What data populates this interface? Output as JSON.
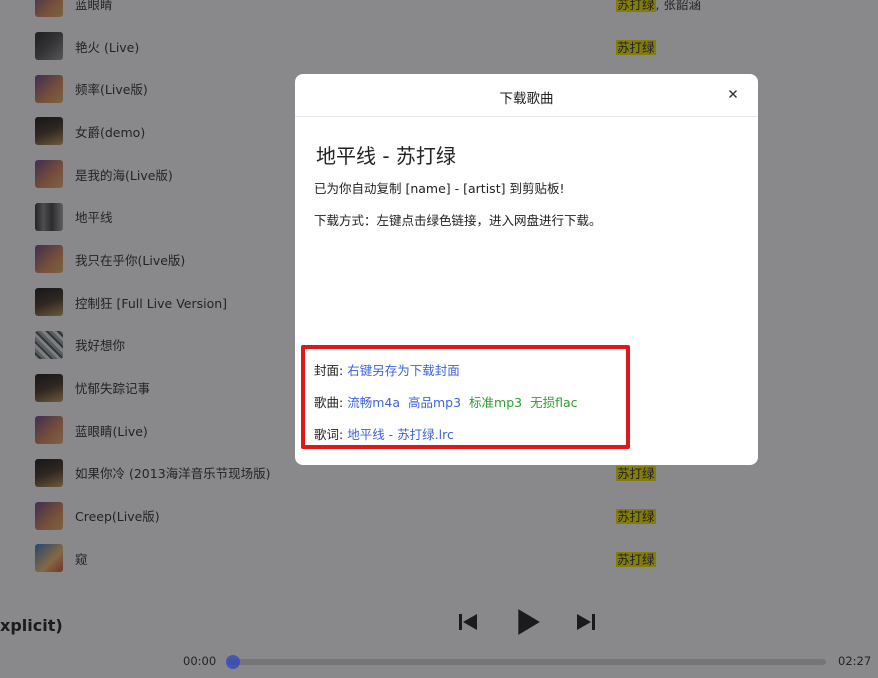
{
  "songs": [
    {
      "name": "蓝眼睛",
      "artist": "苏打绿",
      "artist_extra": ", 张韶涵",
      "cover": "c0"
    },
    {
      "name": "艳火 (Live)",
      "artist": "苏打绿",
      "artist_extra": "",
      "cover": "c1"
    },
    {
      "name": "频率(Live版)",
      "artist": "",
      "artist_extra": "",
      "cover": "c0"
    },
    {
      "name": "女爵(demo)",
      "artist": "",
      "artist_extra": "",
      "cover": "c2"
    },
    {
      "name": "是我的海(Live版)",
      "artist": "",
      "artist_extra": "",
      "cover": "c0"
    },
    {
      "name": "地平线",
      "artist": "",
      "artist_extra": "",
      "cover": "c5"
    },
    {
      "name": "我只在乎你(Live版)",
      "artist": "",
      "artist_extra": "",
      "cover": "c0"
    },
    {
      "name": "控制狂 [Full Live Version]",
      "artist": "",
      "artist_extra": "",
      "cover": "c2"
    },
    {
      "name": "我好想你",
      "artist": "",
      "artist_extra": "",
      "cover": "c3"
    },
    {
      "name": "忧郁失踪记事",
      "artist": "",
      "artist_extra": "",
      "cover": "c2"
    },
    {
      "name": "蓝眼睛(Live)",
      "artist": "",
      "artist_extra": "",
      "cover": "c0"
    },
    {
      "name": "如果你冷 (2013海洋音乐节现场版)",
      "artist": "苏打绿",
      "artist_extra": "",
      "cover": "c2"
    },
    {
      "name": "Creep(Live版)",
      "artist": "苏打绿",
      "artist_extra": "",
      "cover": "c0"
    },
    {
      "name": "窥",
      "artist": "苏打绿",
      "artist_extra": "",
      "cover": "c4"
    }
  ],
  "player": {
    "now_title": "xplicit)",
    "current_time": "00:00",
    "total_time": "02:27",
    "progress": 0.0
  },
  "modal": {
    "title": "下载歌曲",
    "close_label": "×",
    "song_heading": "地平线 - 苏打绿",
    "copy_notice": "已为你自动复制 [name] - [artist] 到剪贴板!",
    "download_hint": "下载方式：左键点击绿色链接，进入网盘进行下载。",
    "cover_label": "封面:",
    "cover_link": "右键另存为下载封面",
    "song_label": "歌曲:",
    "quality_links": [
      {
        "label": "流畅m4a",
        "color": "blue"
      },
      {
        "label": "高品mp3",
        "color": "blue"
      },
      {
        "label": "标准mp3",
        "color": "green"
      },
      {
        "label": "无损flac",
        "color": "green"
      }
    ],
    "lyrics_label": "歌词:",
    "lyrics_link": "地平线 - 苏打绿.lrc"
  },
  "colors": {
    "highlight": "#f2e600",
    "link_blue": "#3d63dd",
    "link_green": "#2e9e2e",
    "annotation_red": "#e0161b",
    "accent": "#2d46c2"
  }
}
